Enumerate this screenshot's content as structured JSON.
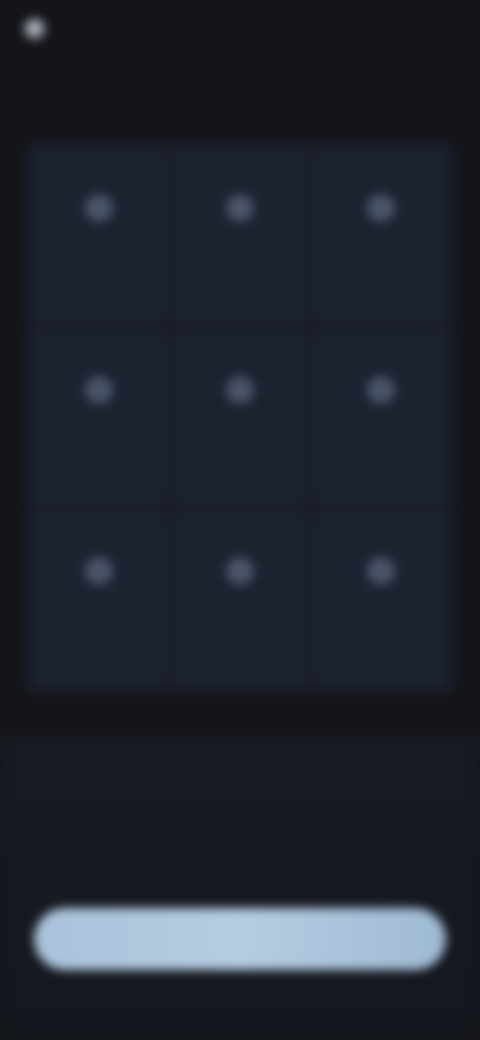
{
  "app": {
    "name": ""
  },
  "tiles": [
    {
      "label": "",
      "icon": "circle-icon"
    },
    {
      "label": "",
      "icon": "circle-icon"
    },
    {
      "label": "",
      "icon": "circle-icon"
    },
    {
      "label": "",
      "icon": "circle-icon"
    },
    {
      "label": "",
      "icon": "circle-icon"
    },
    {
      "label": "",
      "icon": "circle-icon"
    },
    {
      "label": "",
      "icon": "circle-icon"
    },
    {
      "label": "",
      "icon": "circle-icon"
    },
    {
      "label": "",
      "icon": "circle-icon"
    }
  ],
  "cta": {
    "headline": "",
    "subtext": "",
    "button_label": ""
  },
  "colors": {
    "background": "#141519",
    "tile": "#1c2230",
    "button": "#b0c8de"
  }
}
